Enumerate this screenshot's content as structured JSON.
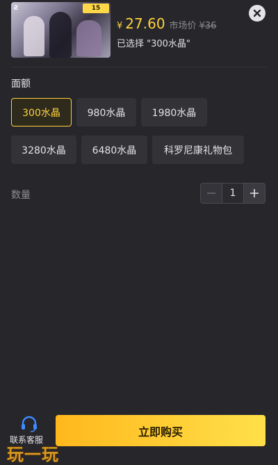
{
  "product": {
    "badge": "15",
    "currency_symbol": "¥",
    "price": "27.60",
    "market_label": "市场价",
    "market_price": "¥36",
    "selected_text": "已选择 \"300水晶\""
  },
  "denomination": {
    "label": "面额",
    "options": [
      "300水晶",
      "980水晶",
      "1980水晶",
      "3280水晶",
      "6480水晶",
      "科罗尼康礼物包"
    ],
    "selected_index": 0
  },
  "quantity": {
    "label": "数量",
    "value": "1",
    "minus_symbol": "−",
    "plus_symbol": "+"
  },
  "footer": {
    "service_label": "联系客服",
    "service_icon": "headset-icon",
    "buy_label": "立即购买",
    "watermark": "玩一玩"
  },
  "colors": {
    "background": "#26262b",
    "accent": "#ffd23f",
    "button_gradient_start": "#ffb81c",
    "button_gradient_end": "#ffe04a"
  }
}
